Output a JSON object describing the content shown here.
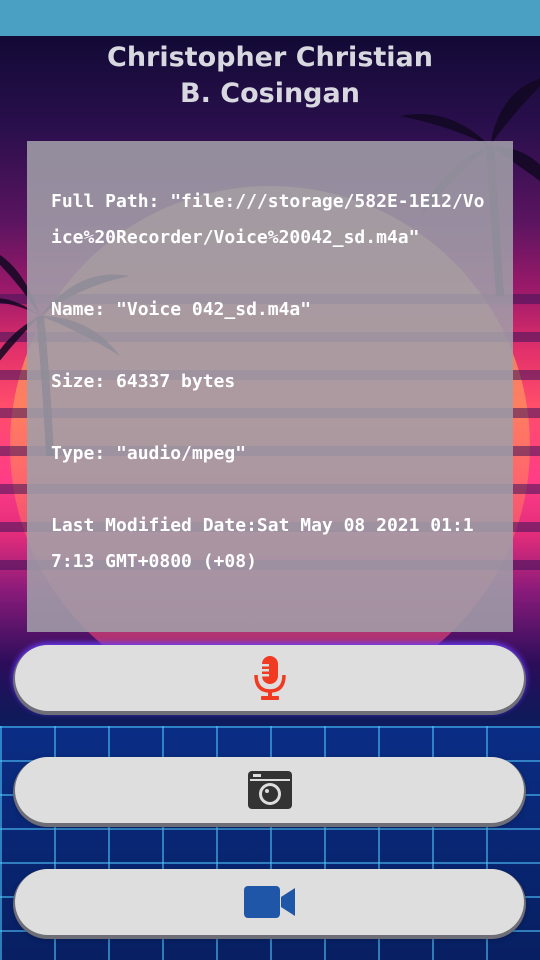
{
  "title": {
    "line1": "Christopher Christian",
    "line2": "B. Cosingan"
  },
  "file_info": {
    "full_path": "Full Path: \"file:///storage/582E-1E12/Voice%20Recorder/Voice%20042_sd.m4a\"",
    "name": "Name: \"Voice 042_sd.m4a\"",
    "size": "Size: 64337 bytes",
    "type": "Type: \"audio/mpeg\"",
    "last_modified": "Last Modified Date:Sat May 08 2021 01:17:13 GMT+0800 (+08)"
  },
  "buttons": [
    {
      "icon": "microphone-icon",
      "color": "#f03a22"
    },
    {
      "icon": "camera-icon",
      "color": "#333333"
    },
    {
      "icon": "video-camera-icon",
      "color": "#1f56a8"
    }
  ],
  "colors": {
    "status_bar": "#4aa0c2",
    "panel": "#a09ea8",
    "button": "#dedede"
  }
}
